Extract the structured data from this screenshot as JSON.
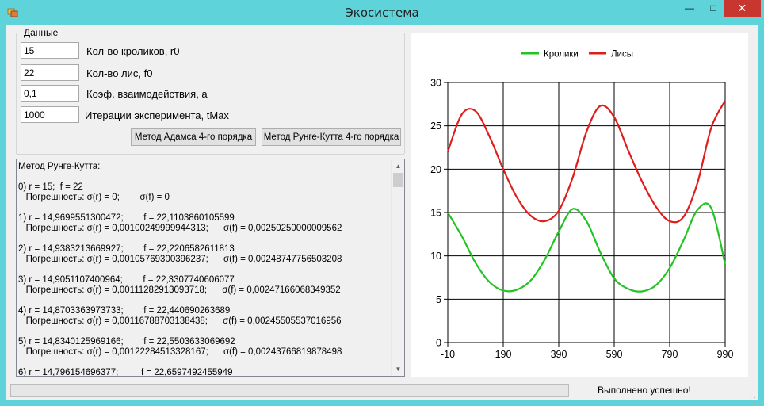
{
  "window": {
    "title": "Экосистема"
  },
  "group": {
    "title": "Данные",
    "fields": [
      {
        "value": "15",
        "label": "Кол-во кроликов, r0"
      },
      {
        "value": "22",
        "label": "Кол-во лис, f0"
      },
      {
        "value": "0,1",
        "label": "Коэф. взаимодействия, a"
      },
      {
        "value": "1000",
        "label": "Итерации эксперимента, tMax"
      }
    ],
    "buttons": {
      "adams": "Метод Адамса 4-го порядка",
      "rk": "Метод Рунге-Кутта 4-го порядка"
    }
  },
  "log": {
    "lines": [
      "Метод Рунге-Кутта:",
      "",
      "0) r = 15;  f = 22",
      "   Погрешность: σ(r) = 0;        σ(f) = 0",
      "",
      "1) r = 14,9699551300472;        f = 22,1103860105599",
      "   Погрешность: σ(r) = 0,00100249999944313;      σ(f) = 0,00250250000009562",
      "",
      "2) r = 14,9383213669927;        f = 22,2206582611813",
      "   Погрешность: σ(r) = 0,00105769300396237;      σ(f) = 0,00248747756503208",
      "",
      "3) r = 14,9051107400964;        f = 22,3307740606077",
      "   Погрешность: σ(r) = 0,00111282913093718;      σ(f) = 0,00247166068349352",
      "",
      "4) r = 14,8703363973733;        f = 22,440690263689",
      "   Погрешность: σ(r) = 0,00116788703138438;      σ(f) = 0,00245505537016956",
      "",
      "5) r = 14,8340125969166;        f = 22,5503633069692",
      "   Погрешность: σ(r) = 0,00122284513328167;      σ(f) = 0,00243766819878498",
      "",
      "6) r = 14,796154696377;         f = 22,6597492455949"
    ]
  },
  "status": {
    "text": "Выполнено успешно!",
    "progress": 0
  },
  "colors": {
    "rabbits": "#22c322",
    "foxes": "#e01d1d",
    "window_frame": "#5fd3da"
  },
  "icons": {
    "app": "app-icon",
    "minimize": "minimize-icon",
    "maximize": "maximize-icon",
    "close": "close-icon",
    "scroll_up": "chevron-up-icon",
    "scroll_down": "chevron-down-icon",
    "grip": "resize-grip-icon"
  },
  "chart_data": {
    "type": "line",
    "legend": [
      "Кролики",
      "Лисы"
    ],
    "legend_position": "top-center",
    "xlim": [
      -10,
      990
    ],
    "ylim": [
      0,
      30
    ],
    "xticks": [
      "-10",
      "190",
      "390",
      "590",
      "790",
      "990"
    ],
    "yticks": [
      "0",
      "5",
      "10",
      "15",
      "20",
      "25",
      "30"
    ],
    "grid": true,
    "series": [
      {
        "name": "Кролики",
        "color": "#22c322",
        "x": [
          -10,
          40,
          90,
          140,
          190,
          240,
          290,
          340,
          390,
          440,
          490,
          540,
          590,
          640,
          690,
          740,
          790,
          840,
          890,
          940,
          990
        ],
        "y": [
          15,
          12.3,
          9.2,
          7.0,
          6.0,
          6.1,
          7.2,
          9.6,
          12.8,
          15.4,
          14.0,
          10.4,
          7.4,
          6.2,
          5.9,
          6.6,
          8.6,
          11.8,
          15.3,
          15.5,
          9.0
        ]
      },
      {
        "name": "Лисы",
        "color": "#e01d1d",
        "x": [
          -10,
          40,
          90,
          140,
          190,
          240,
          290,
          340,
          390,
          440,
          490,
          540,
          590,
          640,
          690,
          740,
          790,
          840,
          890,
          940,
          990
        ],
        "y": [
          22,
          26.3,
          26.7,
          23.8,
          20.0,
          16.7,
          14.6,
          14.0,
          15.2,
          19.0,
          24.3,
          27.3,
          26.0,
          22.2,
          18.6,
          15.7,
          14.0,
          14.5,
          18.4,
          24.8,
          27.9
        ]
      }
    ]
  }
}
